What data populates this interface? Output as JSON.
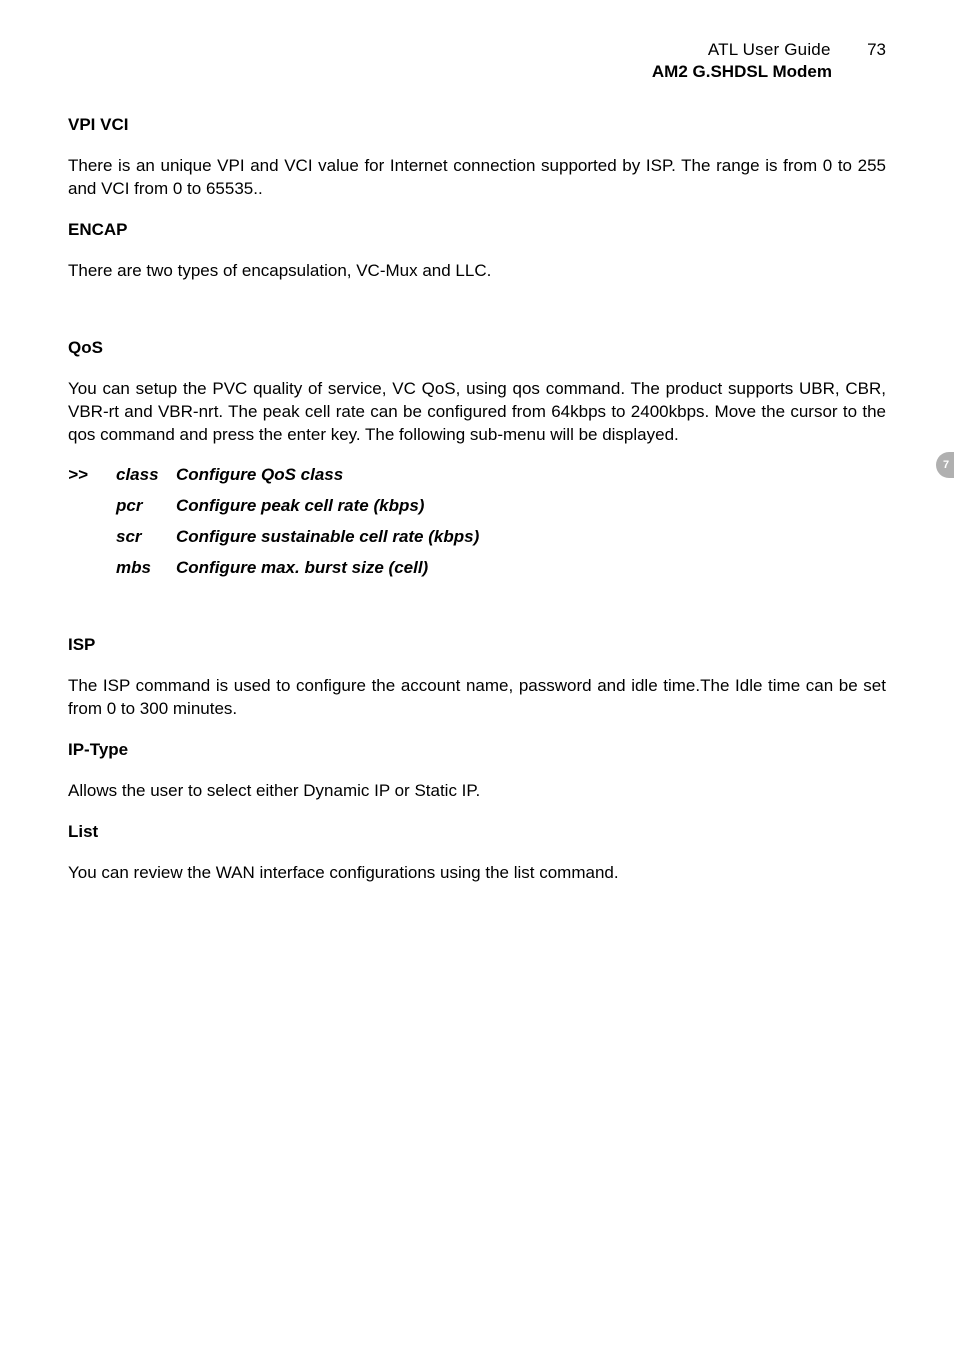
{
  "header": {
    "guide_title": "ATL User Guide",
    "page_number": "73",
    "product_title": "AM2 G.SHDSL Modem"
  },
  "side_tab": "7",
  "sections": {
    "vpi_vci": {
      "heading": "VPI VCI",
      "body": "There is an unique VPI and VCI value for Internet connection supported by ISP. The range is from 0 to 255 and VCI from 0 to 65535.."
    },
    "encap": {
      "heading": "ENCAP",
      "body": "There are two types of encapsulation, VC-Mux and LLC."
    },
    "qos": {
      "heading": "QoS",
      "body": "You can setup the PVC quality of service, VC QoS, using qos command. The product supports UBR, CBR, VBR-rt and VBR-nrt. The peak cell rate can be configured from 64kbps to 2400kbps. Move the cursor to the qos command and press the enter key. The following sub-menu will be displayed."
    },
    "isp": {
      "heading": "ISP",
      "body": "The ISP command is used to configure the account name, password and idle time.The Idle time can be set from 0 to 300 minutes."
    },
    "ip_type": {
      "heading": "IP-Type",
      "body": "Allows the user to select either Dynamic IP  or Static IP."
    },
    "list": {
      "heading": "List",
      "body": "You can review the WAN interface configurations using the list command."
    }
  },
  "command_table": {
    "cursor": ">>",
    "rows": [
      {
        "cmd": "class",
        "desc": "Configure QoS class"
      },
      {
        "cmd": "pcr",
        "desc": "Configure peak cell rate (kbps)"
      },
      {
        "cmd": "scr",
        "desc": "Configure sustainable cell rate (kbps)"
      },
      {
        "cmd": "mbs",
        "desc": "Configure max. burst size (cell)"
      }
    ]
  }
}
